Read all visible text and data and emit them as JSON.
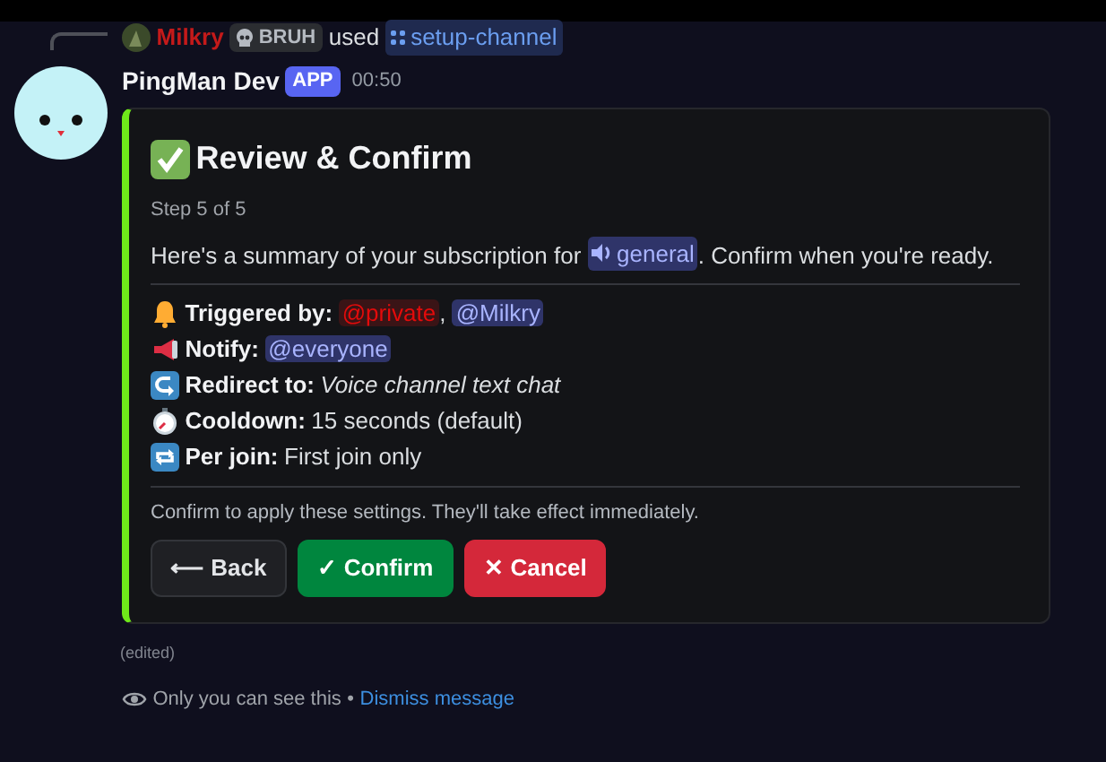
{
  "reply": {
    "user": "Milkry",
    "tag": "BRUH",
    "verb": "used",
    "command": "setup-channel"
  },
  "message": {
    "author": "PingMan Dev",
    "badge": "APP",
    "time": "00:50",
    "edited": "(edited)"
  },
  "embed": {
    "title": "Review & Confirm",
    "step": "Step 5 of 5",
    "summary": [
      {
        "kind": "text",
        "text": "Here's a summary of your subscription for "
      },
      {
        "kind": "channel",
        "text": "general"
      },
      {
        "kind": "text",
        "text": ". Confirm when you're ready."
      }
    ],
    "fields": [
      {
        "label": "Triggered by:",
        "value": [
          {
            "kind": "role",
            "text": "@private"
          },
          {
            "kind": "text",
            "text": ", "
          },
          {
            "kind": "user",
            "text": "@Milkry"
          }
        ]
      },
      {
        "label": "Notify:",
        "value": [
          {
            "kind": "user",
            "text": "@everyone"
          }
        ]
      },
      {
        "label": "Redirect to:",
        "value": [
          {
            "kind": "italic",
            "text": "Voice channel text chat"
          }
        ]
      },
      {
        "label": "Cooldown:",
        "value": [
          {
            "kind": "text",
            "text": "15 seconds (default)"
          }
        ]
      },
      {
        "label": "Per join:",
        "value": [
          {
            "kind": "text",
            "text": "First join only"
          }
        ]
      }
    ],
    "footer": "Confirm to apply these settings. They'll take effect immediately."
  },
  "buttons": [
    {
      "kind": "secondary",
      "label": "⟵ Back"
    },
    {
      "kind": "success",
      "label": "✓ Confirm"
    },
    {
      "kind": "danger",
      "label": "✕ Cancel"
    }
  ],
  "ephemeral": {
    "note": "Only you can see this",
    "separator": "•",
    "link": "Dismiss message"
  }
}
